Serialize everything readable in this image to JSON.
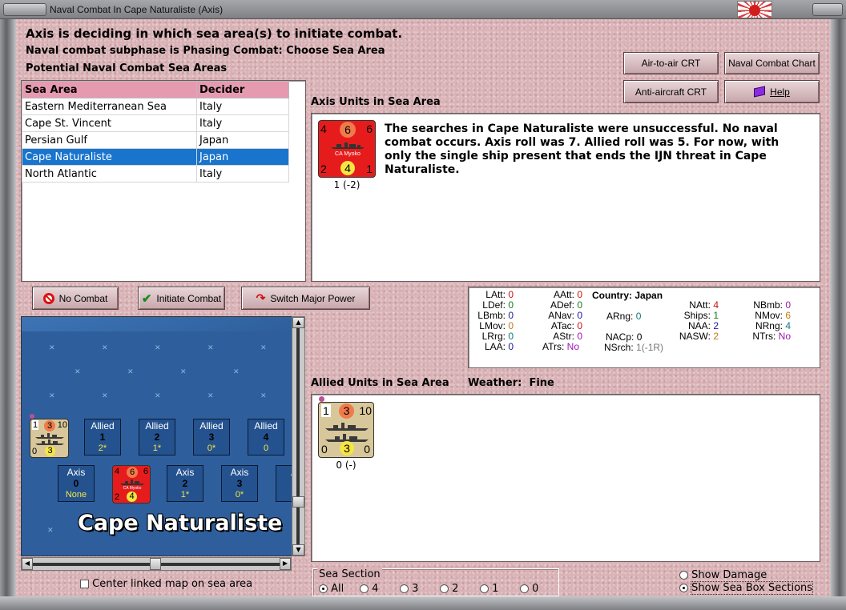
{
  "window": {
    "title": "Naval Combat In Cape Naturaliste (Axis)"
  },
  "header": {
    "status": "Axis is deciding in which sea area(s) to initiate combat.",
    "subphase": "Naval combat subphase is Phasing Combat: Choose Sea Area",
    "potential_label": "Potential Naval Combat Sea Areas"
  },
  "buttons": {
    "air_to_air": "Air-to-air CRT",
    "naval_chart": "Naval Combat Chart",
    "anti_aircraft": "Anti-aircraft CRT",
    "help": "Help",
    "no_combat": "No Combat",
    "initiate": "Initiate Combat",
    "switch_power": "Switch Major Power"
  },
  "sea_table": {
    "headers": [
      "Sea Area",
      "Decider"
    ],
    "rows": [
      {
        "area": "Eastern Mediterranean Sea",
        "decider": "Italy"
      },
      {
        "area": "Cape St. Vincent",
        "decider": "Italy"
      },
      {
        "area": "Persian Gulf",
        "decider": "Japan"
      },
      {
        "area": "Cape Naturaliste",
        "decider": "Japan"
      },
      {
        "area": "North Atlantic",
        "decider": "Italy"
      }
    ],
    "selected_index": 3
  },
  "axis_units": {
    "label": "Axis Units in Sea Area",
    "message": "The searches in Cape Naturaliste were unsuccessful.  No naval combat occurs.  Axis roll was 7.  Allied roll was 5.  For now, with only the single ship present that ends the IJN threat in Cape Naturaliste.",
    "counter": {
      "tl": "4",
      "tc": "6",
      "tr": "6",
      "name": "CA Myoko",
      "bl": "2",
      "bc": "4",
      "br": "1",
      "caption": "1 (-2)"
    }
  },
  "stats": {
    "country_label": "Country:",
    "country": "Japan",
    "col1": [
      {
        "k": "LAtt:",
        "v": "0",
        "c": "c-red"
      },
      {
        "k": "LDef:",
        "v": "0",
        "c": "c-green"
      },
      {
        "k": "LBmb:",
        "v": "0",
        "c": "c-blue"
      },
      {
        "k": "LMov:",
        "v": "0",
        "c": "c-orange"
      },
      {
        "k": "LRrg:",
        "v": "0",
        "c": "c-teal"
      },
      {
        "k": "LAA:",
        "v": "0",
        "c": "c-blue"
      }
    ],
    "col2": [
      {
        "k": "AAtt:",
        "v": "0",
        "c": "c-red"
      },
      {
        "k": "ADef:",
        "v": "0",
        "c": "c-green"
      },
      {
        "k": "ANav:",
        "v": "0",
        "c": "c-blue"
      },
      {
        "k": "ATac:",
        "v": "0",
        "c": "c-red"
      },
      {
        "k": "AStr:",
        "v": "0",
        "c": "c-purple"
      },
      {
        "k": "ATrs:",
        "v": "No",
        "c": "c-purple"
      }
    ],
    "col3": [
      {
        "k": "",
        "v": "",
        "c": ""
      },
      {
        "k": "",
        "v": "",
        "c": ""
      },
      {
        "k": "ARng:",
        "v": "0",
        "c": "c-teal"
      },
      {
        "k": "",
        "v": "",
        "c": ""
      },
      {
        "k": "NACp:",
        "v": "0",
        "c": ""
      },
      {
        "k": "NSrch:",
        "v": "1(-1R)",
        "c": "c-gray"
      }
    ],
    "col4": [
      {
        "k": "NAtt:",
        "v": "4",
        "c": "c-red"
      },
      {
        "k": "Ships:",
        "v": "1",
        "c": "c-green"
      },
      {
        "k": "NAA:",
        "v": "2",
        "c": "c-blue"
      },
      {
        "k": "NASW:",
        "v": "2",
        "c": "c-orange"
      }
    ],
    "col5": [
      {
        "k": "NBmb:",
        "v": "0",
        "c": "c-purple"
      },
      {
        "k": "NMov:",
        "v": "6",
        "c": "c-orange"
      },
      {
        "k": "NRng:",
        "v": "4",
        "c": "c-teal"
      },
      {
        "k": "NTrs:",
        "v": "No",
        "c": "c-purple"
      }
    ]
  },
  "allied_units": {
    "label": "Allied Units in Sea Area",
    "weather_label": "Weather:",
    "weather": "Fine",
    "counter": {
      "tl": "1",
      "tc": "3",
      "tr": "10",
      "bl": "0",
      "bc": "3",
      "br": "0",
      "caption": "0 (-)"
    }
  },
  "seamap": {
    "area_name": "Cape Naturaliste",
    "allied_boxes": [
      {
        "side": "Allied",
        "num": "1",
        "sub": "2*"
      },
      {
        "side": "Allied",
        "num": "2",
        "sub": "1*"
      },
      {
        "side": "Allied",
        "num": "3",
        "sub": "0*"
      },
      {
        "side": "Allied",
        "num": "4",
        "sub": "0"
      }
    ],
    "axis_boxes": [
      {
        "side": "Axis",
        "num": "0",
        "sub": "None"
      },
      {
        "side": "Axis",
        "num": "2",
        "sub": "1*"
      },
      {
        "side": "Axis",
        "num": "3",
        "sub": "0*"
      },
      {
        "side": "A",
        "num": "",
        "sub": ""
      }
    ],
    "mini_allied": {
      "tl": "1",
      "tc": "3",
      "tr": "10",
      "bl": "0",
      "bc": "3"
    },
    "mini_axis": {
      "tl": "4",
      "tc": "6",
      "tr": "6",
      "name": "CA Myoko",
      "bl": "2",
      "bc": "4"
    }
  },
  "footer": {
    "center_map": "Center linked map on sea area",
    "sea_section_label": "Sea Section",
    "sea_sections": [
      "All",
      "4",
      "3",
      "2",
      "1",
      "0"
    ],
    "show_damage": "Show Damage",
    "show_sections": "Show Sea Box Sections"
  },
  "colors": {
    "selection": "#1874cd",
    "table_header": "#e69ab0",
    "axis_counter": "#e61c1c",
    "allied_counter": "#d8c79a",
    "sea": "#2e5f9c"
  }
}
